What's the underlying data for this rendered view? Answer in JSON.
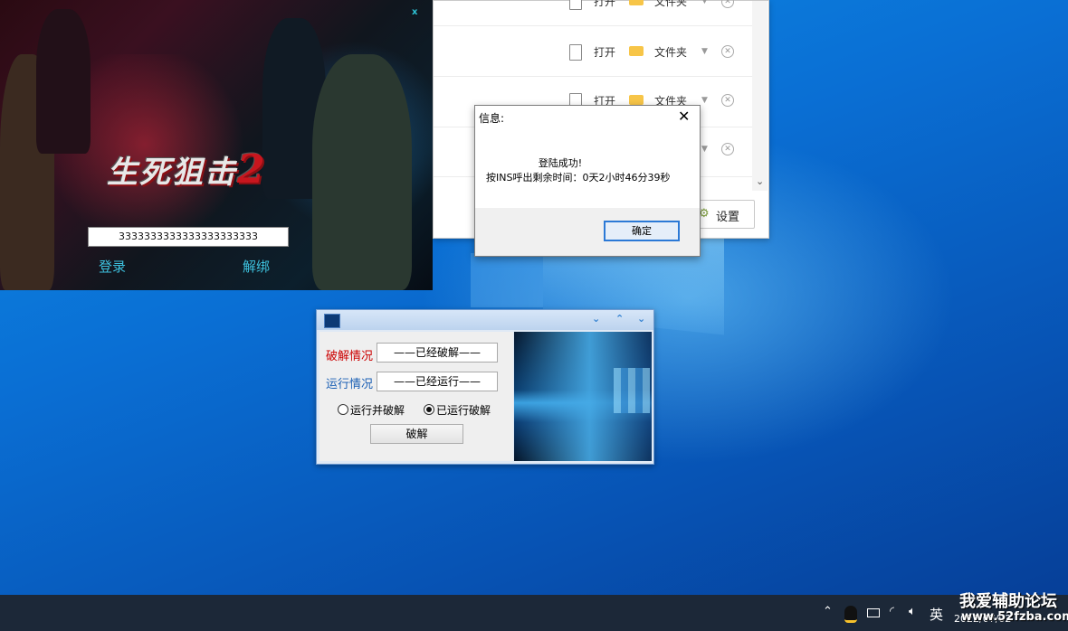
{
  "file_manager": {
    "rows": [
      {
        "open_label": "打开",
        "folder_label": "文件夹"
      },
      {
        "open_label": "打开",
        "folder_label": "文件夹"
      },
      {
        "open_label": "打开",
        "folder_label": "文件夹"
      },
      {
        "open_label": "",
        "folder_label": ""
      }
    ],
    "settings_label": "设置"
  },
  "launcher": {
    "logo_text": "生死狙击",
    "logo_suffix": "2",
    "close_label": "x",
    "key_value": "3333333333333333333333",
    "login_label": "登录",
    "unbind_label": "解绑"
  },
  "message_box": {
    "title": "信息:",
    "close_label": "✕",
    "line1": "登陆成功!",
    "line2": "按INS呼出剩余时间：0天2小时46分39秒",
    "ok_label": "确定"
  },
  "crack_tool": {
    "titlebar_buttons": [
      "⌄",
      "⌃",
      "⌄"
    ],
    "crack_status_label": "破解情况",
    "crack_status_value": "——已经破解——",
    "run_status_label": "运行情况",
    "run_status_value": "——已经运行——",
    "radio_options": [
      {
        "label": "运行并破解",
        "selected": false
      },
      {
        "label": "已运行破解",
        "selected": true
      }
    ],
    "crack_button_label": "破解"
  },
  "taskbar": {
    "ime_label": "英",
    "clock": "2022/07/02"
  },
  "watermark": {
    "title": "我爱辅助论坛",
    "url": "www.52fzba.com"
  },
  "colors": {
    "launcher_accent": "#3dc1de",
    "crack_label": "#cc0000",
    "run_label": "#1a5fb4",
    "ok_border": "#2b79d6"
  }
}
